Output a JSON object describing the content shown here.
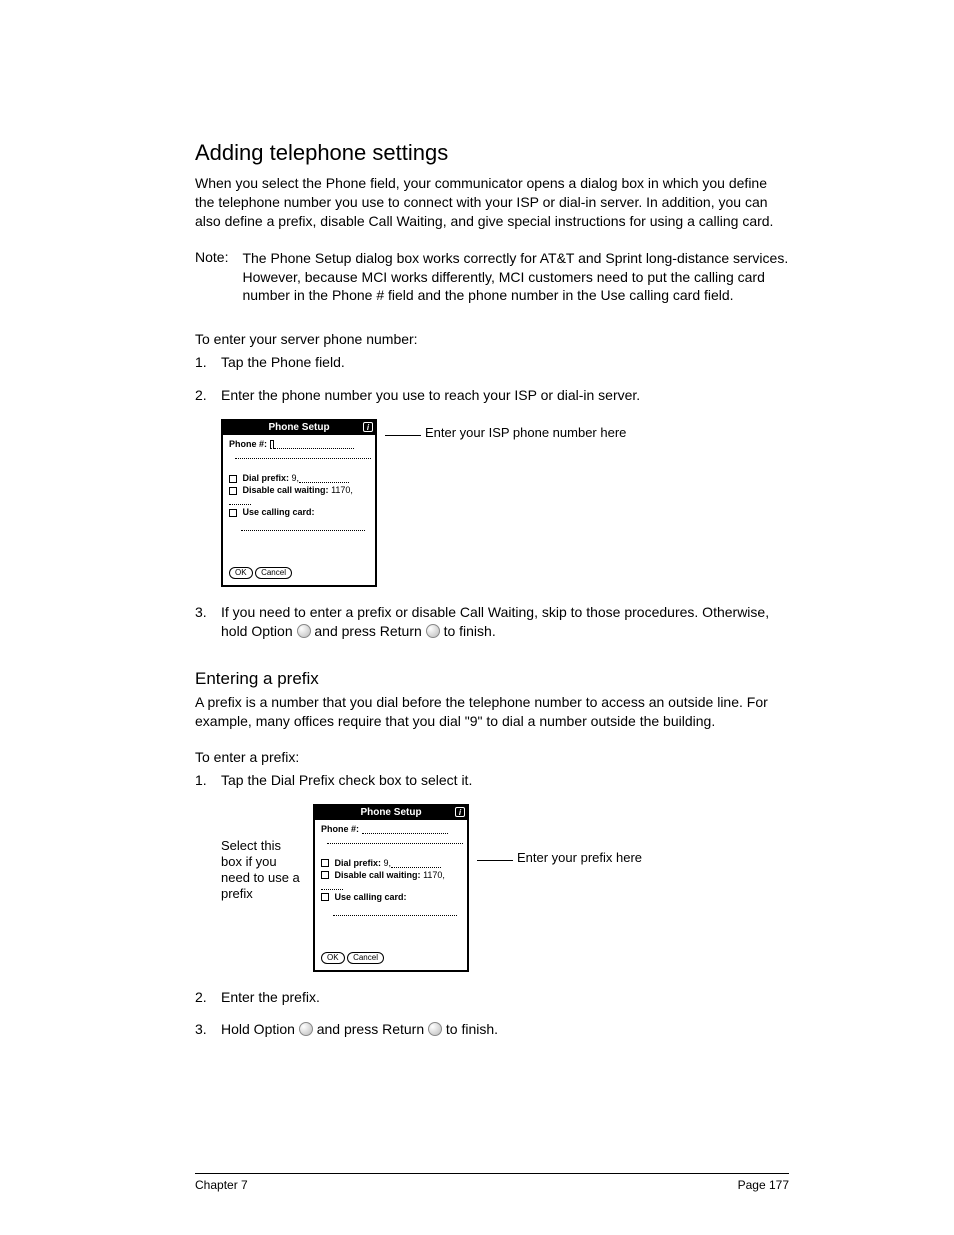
{
  "h2": "Adding telephone settings",
  "intro": "When you select the Phone field, your communicator opens a dialog box in which you define the telephone number you use to connect with your ISP or dial-in server. In addition, you can also define a prefix, disable Call Waiting, and give special instructions for using a calling card.",
  "note": {
    "label": "Note:",
    "body": "The Phone Setup dialog box works correctly for AT&T and Sprint long-distance services. However, because MCI works differently, MCI customers need to put the calling card number in the Phone # field and the phone number in the Use calling card field."
  },
  "proc1": {
    "lead": "To enter your server phone number:",
    "s1": "Tap the Phone field.",
    "s2": "Enter the phone number you use to reach your ISP or dial-in server.",
    "s3a": "If you need to enter a prefix or disable Call Waiting, skip to those procedures. Otherwise, hold Option ",
    "s3b": " and press Return ",
    "s3c": " to finish."
  },
  "dialog": {
    "title": "Phone Setup",
    "phone_label": "Phone #:",
    "dial_prefix": "Dial prefix:",
    "dial_prefix_val": "9,",
    "disable_cw": "Disable call waiting:",
    "disable_cw_val": "1170,",
    "use_cc": "Use calling card:",
    "ok": "OK",
    "cancel": "Cancel"
  },
  "callout1": "Enter your ISP phone number here",
  "h3": "Entering a prefix",
  "prefix_intro": "A prefix is a number that you dial before the telephone number to access an outside line. For example, many offices require that you dial \"9\" to dial a number outside the building.",
  "proc2": {
    "lead": "To enter a prefix:",
    "s1": "Tap the Dial Prefix check box to select it.",
    "s2": "Enter the prefix.",
    "s3a": "Hold Option ",
    "s3b": " and press Return ",
    "s3c": " to finish."
  },
  "callout_left": "Select this box if you need to use a prefix",
  "callout_right": "Enter your prefix here",
  "footer": {
    "left": "Chapter 7",
    "right": "Page 177"
  }
}
